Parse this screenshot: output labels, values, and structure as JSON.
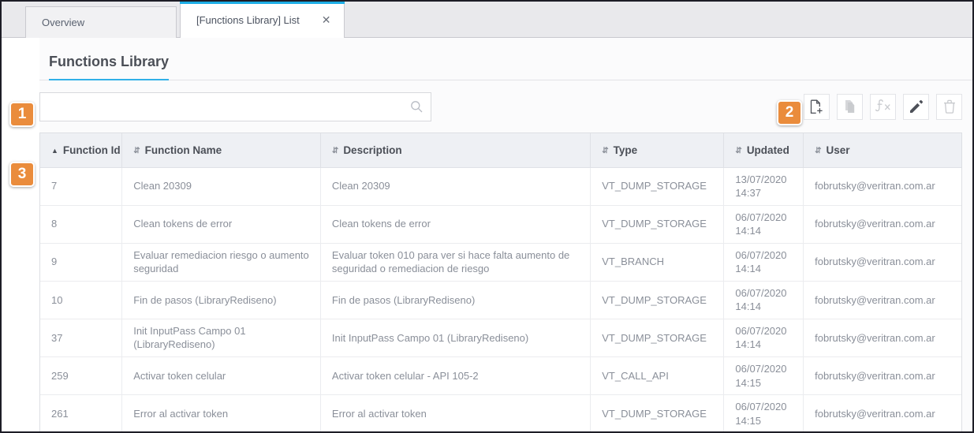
{
  "window": {
    "tabs": [
      {
        "label": "Overview",
        "active": false,
        "closable": false
      },
      {
        "label": "[Functions Library] List",
        "active": true,
        "closable": true,
        "close_icon": "close-icon"
      }
    ]
  },
  "page": {
    "title": "Functions Library",
    "accent_color": "#31b0e8",
    "badge_color": "#ea8c3c"
  },
  "search": {
    "value": "",
    "placeholder": "",
    "icon": "search-icon"
  },
  "toolbar": {
    "buttons": [
      {
        "name": "new-function-button",
        "icon": "document-plus-icon",
        "state": "enabled",
        "label": "New"
      },
      {
        "name": "duplicate-button",
        "icon": "copy-icon",
        "state": "disabled",
        "label": "Duplicate"
      },
      {
        "name": "function-editor-button",
        "icon": "fx-icon",
        "state": "disabled",
        "label": "Fx"
      },
      {
        "name": "edit-button",
        "icon": "pencil-icon",
        "state": "enabled",
        "label": "Edit"
      },
      {
        "name": "delete-button",
        "icon": "trash-icon",
        "state": "disabled",
        "label": "Delete"
      }
    ]
  },
  "badges": [
    {
      "number": "1",
      "target": "search-input"
    },
    {
      "number": "2",
      "target": "toolbar"
    },
    {
      "number": "3",
      "target": "results-table"
    }
  ],
  "table": {
    "columns": [
      {
        "label": "Function Id",
        "sort": "asc",
        "key": "function_id"
      },
      {
        "label": "Function Name",
        "sort": "none",
        "key": "function_name"
      },
      {
        "label": "Description",
        "sort": "none",
        "key": "description"
      },
      {
        "label": "Type",
        "sort": "none",
        "key": "type"
      },
      {
        "label": "Updated",
        "sort": "none",
        "key": "updated"
      },
      {
        "label": "User",
        "sort": "none",
        "key": "user"
      }
    ],
    "rows": [
      {
        "function_id": "7",
        "function_name": "Clean 20309",
        "description": "Clean 20309",
        "type": "VT_DUMP_STORAGE",
        "updated": "13/07/2020 14:37",
        "user": "fobrutsky@veritran.com.ar"
      },
      {
        "function_id": "8",
        "function_name": "Clean tokens de error",
        "description": "Clean tokens de error",
        "type": "VT_DUMP_STORAGE",
        "updated": "06/07/2020 14:14",
        "user": "fobrutsky@veritran.com.ar"
      },
      {
        "function_id": "9",
        "function_name": "Evaluar remediacion riesgo o aumento seguridad",
        "description": "Evaluar token 010 para ver si hace falta aumento de seguridad o remediacion de riesgo",
        "type": "VT_BRANCH",
        "updated": "06/07/2020 14:14",
        "user": "fobrutsky@veritran.com.ar"
      },
      {
        "function_id": "10",
        "function_name": "Fin de pasos (LibraryRediseno)",
        "description": "Fin de pasos (LibraryRediseno)",
        "type": "VT_DUMP_STORAGE",
        "updated": "06/07/2020 14:14",
        "user": "fobrutsky@veritran.com.ar"
      },
      {
        "function_id": "37",
        "function_name": "Init InputPass Campo 01 (LibraryRediseno)",
        "description": "Init InputPass Campo 01 (LibraryRediseno)",
        "type": "VT_DUMP_STORAGE",
        "updated": "06/07/2020 14:14",
        "user": "fobrutsky@veritran.com.ar"
      },
      {
        "function_id": "259",
        "function_name": "Activar token celular",
        "description": "Activar token celular - API 105-2",
        "type": "VT_CALL_API",
        "updated": "06/07/2020 14:15",
        "user": "fobrutsky@veritran.com.ar"
      },
      {
        "function_id": "261",
        "function_name": "Error al activar token",
        "description": "Error al activar token",
        "type": "VT_DUMP_STORAGE",
        "updated": "06/07/2020 14:15",
        "user": "fobrutsky@veritran.com.ar"
      }
    ]
  }
}
